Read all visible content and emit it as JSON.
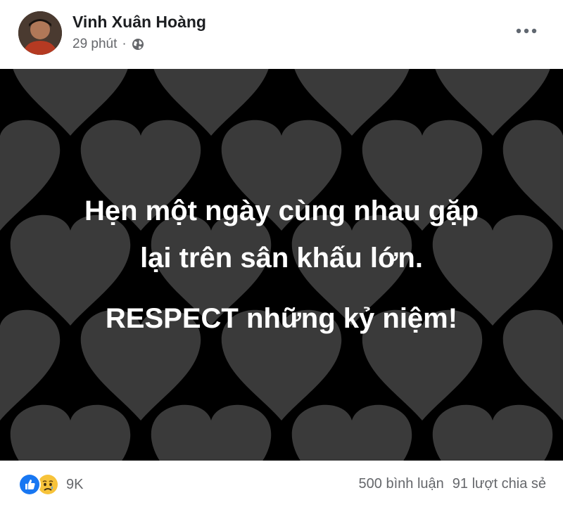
{
  "post": {
    "author": "Vinh Xuân Hoàng",
    "time": "29 phút",
    "separator": "·",
    "privacy_icon": "globe-icon",
    "more_icon": "more-options-icon"
  },
  "image_text": {
    "line1": "Hẹn một ngày cùng nhau gặp",
    "line2": "lại trên sân khấu lớn.",
    "line3": "RESPECT những kỷ niệm!"
  },
  "footer": {
    "reaction_icons": [
      "like-icon",
      "sad-icon"
    ],
    "reaction_count": "9K",
    "comments": "500 bình luận",
    "shares": "91 lượt chia sẻ"
  },
  "colors": {
    "like_blue": "#1877f2",
    "sad_yellow": "#f7c33a",
    "text_secondary": "#65676b",
    "heart_gray": "#3a3a3a"
  }
}
